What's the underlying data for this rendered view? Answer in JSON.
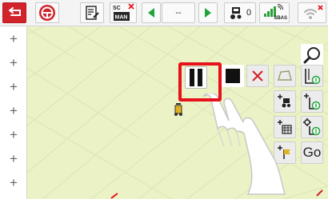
{
  "topbar": {
    "back_icon": "arrow-back-icon",
    "nav_field": "--",
    "satellites": "0",
    "gps_mode": "SBAS",
    "sc_label": "SC",
    "man_label": "MAN"
  },
  "colors": {
    "back_button": "#d2222a",
    "alert_red": "#e8101a",
    "arrow_green": "#1fa33a",
    "map_background": "#eaf2c6",
    "gauge": [
      "#e53935",
      "#f4d03f",
      "#43a047",
      "#f4d03f",
      "#e53935"
    ]
  },
  "left_toolbar": {
    "items": [
      "+",
      "+",
      "+",
      "+",
      "+",
      "+",
      "+",
      "+"
    ]
  },
  "map_tools": {
    "go_label": "Go"
  }
}
